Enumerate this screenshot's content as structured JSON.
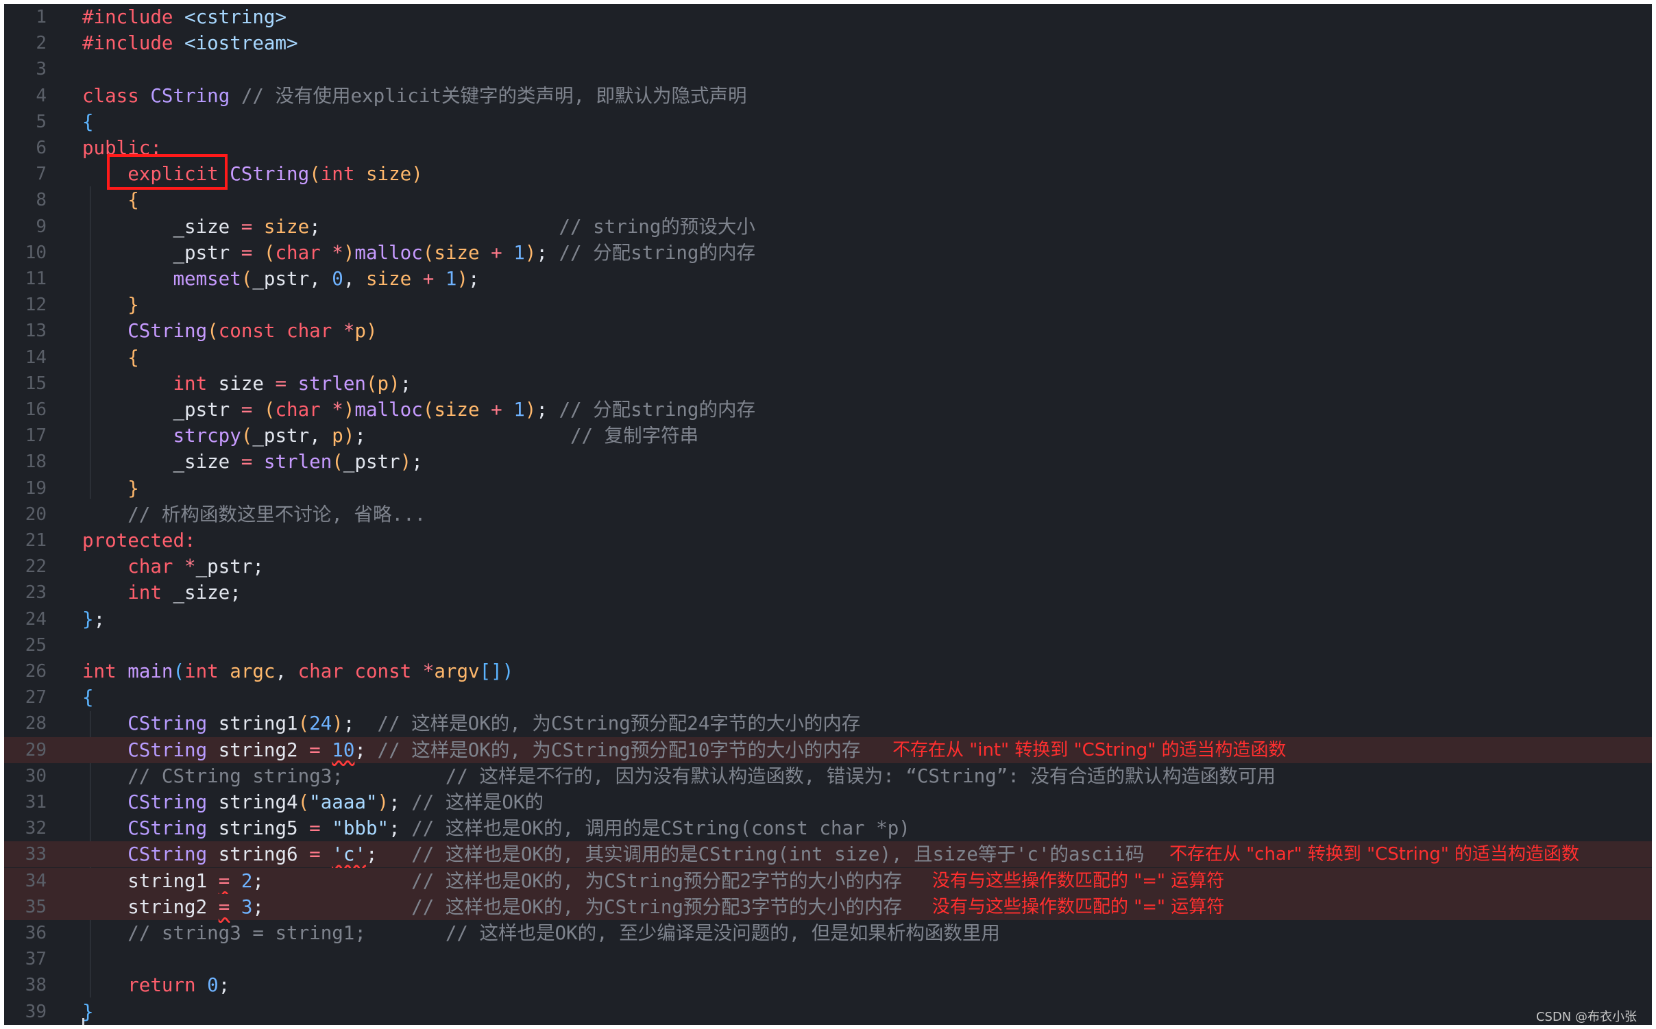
{
  "editor": {
    "lines": [
      {
        "n": "1",
        "tokens": [
          [
            "kw",
            "#include"
          ],
          [
            "txt",
            " "
          ],
          [
            "str",
            "<cstring>"
          ]
        ]
      },
      {
        "n": "2",
        "tokens": [
          [
            "kw",
            "#include"
          ],
          [
            "txt",
            " "
          ],
          [
            "str",
            "<iostream>"
          ]
        ]
      },
      {
        "n": "3",
        "tokens": []
      },
      {
        "n": "4",
        "tokens": [
          [
            "kw",
            "class"
          ],
          [
            "txt",
            " "
          ],
          [
            "cls",
            "CString"
          ],
          [
            "txt",
            " "
          ],
          [
            "cm",
            "// 没有使用explicit关键字的类声明, 即默认为隐式声明"
          ]
        ]
      },
      {
        "n": "5",
        "tokens": [
          [
            "b",
            "{"
          ]
        ]
      },
      {
        "n": "6",
        "tokens": [
          [
            "kw",
            "public:"
          ]
        ]
      },
      {
        "n": "7",
        "tokens": [
          [
            "txt",
            "    "
          ],
          [
            "kw",
            "explicit"
          ],
          [
            "txt",
            " "
          ],
          [
            "fn",
            "CString"
          ],
          [
            "pl",
            "("
          ],
          [
            "ty",
            "int"
          ],
          [
            "txt",
            " "
          ],
          [
            "p",
            "size"
          ],
          [
            "pl",
            ")"
          ]
        ]
      },
      {
        "n": "8",
        "tokens": [
          [
            "txt",
            "    "
          ],
          [
            "pl",
            "{"
          ]
        ]
      },
      {
        "n": "9",
        "tokens": [
          [
            "txt",
            "        _size "
          ],
          [
            "op",
            "="
          ],
          [
            "txt",
            " "
          ],
          [
            "p",
            "size"
          ],
          [
            "txt",
            ";                     "
          ],
          [
            "cm",
            "// string的预设大小"
          ]
        ]
      },
      {
        "n": "10",
        "tokens": [
          [
            "txt",
            "        _pstr "
          ],
          [
            "op",
            "="
          ],
          [
            "txt",
            " "
          ],
          [
            "pl",
            "("
          ],
          [
            "ty",
            "char"
          ],
          [
            "txt",
            " "
          ],
          [
            "op",
            "*"
          ],
          [
            "pl",
            ")"
          ],
          [
            "fn",
            "malloc"
          ],
          [
            "pl",
            "("
          ],
          [
            "p",
            "size"
          ],
          [
            "txt",
            " "
          ],
          [
            "op",
            "+"
          ],
          [
            "txt",
            " "
          ],
          [
            "num",
            "1"
          ],
          [
            "pl",
            ")"
          ],
          [
            "txt",
            "; "
          ],
          [
            "cm",
            "// 分配string的内存"
          ]
        ]
      },
      {
        "n": "11",
        "tokens": [
          [
            "txt",
            "        "
          ],
          [
            "fn",
            "memset"
          ],
          [
            "pl",
            "("
          ],
          [
            "txt",
            "_pstr, "
          ],
          [
            "num",
            "0"
          ],
          [
            "txt",
            ", "
          ],
          [
            "p",
            "size"
          ],
          [
            "txt",
            " "
          ],
          [
            "op",
            "+"
          ],
          [
            "txt",
            " "
          ],
          [
            "num",
            "1"
          ],
          [
            "pl",
            ")"
          ],
          [
            "txt",
            ";"
          ]
        ]
      },
      {
        "n": "12",
        "tokens": [
          [
            "txt",
            "    "
          ],
          [
            "pl",
            "}"
          ]
        ]
      },
      {
        "n": "13",
        "tokens": [
          [
            "txt",
            "    "
          ],
          [
            "fn",
            "CString"
          ],
          [
            "pl",
            "("
          ],
          [
            "ty",
            "const"
          ],
          [
            "txt",
            " "
          ],
          [
            "ty",
            "char"
          ],
          [
            "txt",
            " "
          ],
          [
            "op",
            "*"
          ],
          [
            "p",
            "p"
          ],
          [
            "pl",
            ")"
          ]
        ]
      },
      {
        "n": "14",
        "tokens": [
          [
            "txt",
            "    "
          ],
          [
            "pl",
            "{"
          ]
        ]
      },
      {
        "n": "15",
        "tokens": [
          [
            "txt",
            "        "
          ],
          [
            "ty",
            "int"
          ],
          [
            "txt",
            " size "
          ],
          [
            "op",
            "="
          ],
          [
            "txt",
            " "
          ],
          [
            "fn",
            "strlen"
          ],
          [
            "pl",
            "("
          ],
          [
            "p",
            "p"
          ],
          [
            "pl",
            ")"
          ],
          [
            "txt",
            ";"
          ]
        ]
      },
      {
        "n": "16",
        "tokens": [
          [
            "txt",
            "        _pstr "
          ],
          [
            "op",
            "="
          ],
          [
            "txt",
            " "
          ],
          [
            "pl",
            "("
          ],
          [
            "ty",
            "char"
          ],
          [
            "txt",
            " "
          ],
          [
            "op",
            "*"
          ],
          [
            "pl",
            ")"
          ],
          [
            "fn",
            "malloc"
          ],
          [
            "pl",
            "("
          ],
          [
            "p",
            "size"
          ],
          [
            "txt",
            " "
          ],
          [
            "op",
            "+"
          ],
          [
            "txt",
            " "
          ],
          [
            "num",
            "1"
          ],
          [
            "pl",
            ")"
          ],
          [
            "txt",
            "; "
          ],
          [
            "cm",
            "// 分配string的内存"
          ]
        ]
      },
      {
        "n": "17",
        "tokens": [
          [
            "txt",
            "        "
          ],
          [
            "fn",
            "strcpy"
          ],
          [
            "pl",
            "("
          ],
          [
            "txt",
            "_pstr, "
          ],
          [
            "p",
            "p"
          ],
          [
            "pl",
            ")"
          ],
          [
            "txt",
            ";                  "
          ],
          [
            "cm",
            "// 复制字符串"
          ]
        ]
      },
      {
        "n": "18",
        "tokens": [
          [
            "txt",
            "        _size "
          ],
          [
            "op",
            "="
          ],
          [
            "txt",
            " "
          ],
          [
            "fn",
            "strlen"
          ],
          [
            "pl",
            "("
          ],
          [
            "txt",
            "_pstr"
          ],
          [
            "pl",
            ")"
          ],
          [
            "txt",
            ";"
          ]
        ]
      },
      {
        "n": "19",
        "tokens": [
          [
            "txt",
            "    "
          ],
          [
            "pl",
            "}"
          ]
        ]
      },
      {
        "n": "20",
        "tokens": [
          [
            "txt",
            "    "
          ],
          [
            "cm",
            "// 析构函数这里不讨论, 省略..."
          ]
        ]
      },
      {
        "n": "21",
        "tokens": [
          [
            "kw",
            "protected:"
          ]
        ]
      },
      {
        "n": "22",
        "tokens": [
          [
            "txt",
            "    "
          ],
          [
            "ty",
            "char"
          ],
          [
            "txt",
            " "
          ],
          [
            "op",
            "*"
          ],
          [
            "txt",
            "_pstr;"
          ]
        ]
      },
      {
        "n": "23",
        "tokens": [
          [
            "txt",
            "    "
          ],
          [
            "ty",
            "int"
          ],
          [
            "txt",
            " _size;"
          ]
        ]
      },
      {
        "n": "24",
        "tokens": [
          [
            "b",
            "}"
          ],
          [
            "txt",
            ";"
          ]
        ]
      },
      {
        "n": "25",
        "tokens": []
      },
      {
        "n": "26",
        "tokens": [
          [
            "ty",
            "int"
          ],
          [
            "txt",
            " "
          ],
          [
            "fn",
            "main"
          ],
          [
            "b",
            "("
          ],
          [
            "ty",
            "int"
          ],
          [
            "txt",
            " "
          ],
          [
            "p",
            "argc"
          ],
          [
            "txt",
            ", "
          ],
          [
            "ty",
            "char"
          ],
          [
            "txt",
            " "
          ],
          [
            "ty",
            "const"
          ],
          [
            "txt",
            " "
          ],
          [
            "op",
            "*"
          ],
          [
            "p",
            "argv"
          ],
          [
            "b",
            "[]"
          ],
          [
            "b",
            ")"
          ]
        ]
      },
      {
        "n": "27",
        "tokens": [
          [
            "b",
            "{"
          ]
        ]
      },
      {
        "n": "28",
        "tokens": [
          [
            "txt",
            "    "
          ],
          [
            "cls",
            "CString"
          ],
          [
            "txt",
            " string1"
          ],
          [
            "pl",
            "("
          ],
          [
            "num",
            "24"
          ],
          [
            "pl",
            ")"
          ],
          [
            "txt",
            ";  "
          ],
          [
            "cm",
            "// 这样是OK的, 为CString预分配24字节的大小的内存"
          ]
        ]
      },
      {
        "n": "29",
        "err": true,
        "tokens": [
          [
            "txt",
            "    "
          ],
          [
            "cls",
            "CString"
          ],
          [
            "txt",
            " string2 "
          ],
          [
            "op",
            "="
          ],
          [
            "txt",
            " "
          ],
          [
            "numsq",
            "10"
          ],
          [
            "txt",
            "; "
          ],
          [
            "cm",
            "// 这样是OK的, 为CString预分配10字节的大小的内存"
          ]
        ],
        "msg": "不存在从 \"int\" 转换到 \"CString\" 的适当构造函数",
        "msgLeft": 1296
      },
      {
        "n": "30",
        "tokens": [
          [
            "txt",
            "    "
          ],
          [
            "cm",
            "// CString string3;         // 这样是不行的, 因为没有默认构造函数, 错误为: “CString”: 没有合适的默认构造函数可用"
          ]
        ]
      },
      {
        "n": "31",
        "tokens": [
          [
            "txt",
            "    "
          ],
          [
            "cls",
            "CString"
          ],
          [
            "txt",
            " string4"
          ],
          [
            "pl",
            "("
          ],
          [
            "str",
            "\"aaaa\""
          ],
          [
            "pl",
            ")"
          ],
          [
            "txt",
            "; "
          ],
          [
            "cm",
            "// 这样是OK的"
          ]
        ]
      },
      {
        "n": "32",
        "tokens": [
          [
            "txt",
            "    "
          ],
          [
            "cls",
            "CString"
          ],
          [
            "txt",
            " string5 "
          ],
          [
            "op",
            "="
          ],
          [
            "txt",
            " "
          ],
          [
            "str",
            "\"bbb\""
          ],
          [
            "txt",
            "; "
          ],
          [
            "cm",
            "// 这样也是OK的, 调用的是CString(const char *p)"
          ]
        ]
      },
      {
        "n": "33",
        "err": true,
        "tokens": [
          [
            "txt",
            "    "
          ],
          [
            "cls",
            "CString"
          ],
          [
            "txt",
            " string6 "
          ],
          [
            "op",
            "="
          ],
          [
            "txt",
            " "
          ],
          [
            "strsq",
            "'c'"
          ],
          [
            "txt",
            ";   "
          ],
          [
            "cm",
            "// 这样也是OK的, 其实调用的是CString(int size), 且size等于'c'的ascii码"
          ]
        ],
        "msg": "不存在从 \"char\" 转换到 \"CString\" 的适当构造函数",
        "msgLeft": 1700
      },
      {
        "n": "34",
        "err": true,
        "tokens": [
          [
            "txt",
            "    string1 "
          ],
          [
            "opsq",
            "="
          ],
          [
            "txt",
            " "
          ],
          [
            "num",
            "2"
          ],
          [
            "txt",
            ";             "
          ],
          [
            "cm",
            "// 这样也是OK的, 为CString预分配2字节的大小的内存"
          ]
        ],
        "msg": "没有与这些操作数匹配的 \"=\" 运算符",
        "msgLeft": 1354
      },
      {
        "n": "35",
        "err": true,
        "tokens": [
          [
            "txt",
            "    string2 "
          ],
          [
            "opsq",
            "="
          ],
          [
            "txt",
            " "
          ],
          [
            "num",
            "3"
          ],
          [
            "txt",
            ";             "
          ],
          [
            "cm",
            "// 这样也是OK的, 为CString预分配3字节的大小的内存"
          ]
        ],
        "msg": "没有与这些操作数匹配的 \"=\" 运算符",
        "msgLeft": 1354
      },
      {
        "n": "36",
        "tokens": [
          [
            "txt",
            "    "
          ],
          [
            "cm",
            "// string3 = string1;       // 这样也是OK的, 至少编译是没问题的, 但是如果析构函数里用"
          ]
        ]
      },
      {
        "n": "37",
        "tokens": []
      },
      {
        "n": "38",
        "tokens": [
          [
            "txt",
            "    "
          ],
          [
            "kw",
            "return"
          ],
          [
            "txt",
            " "
          ],
          [
            "num",
            "0"
          ],
          [
            "txt",
            ";"
          ]
        ]
      },
      {
        "n": "39",
        "tokens": [
          [
            "b",
            "}"
          ]
        ]
      }
    ]
  },
  "watermark": "CSDN @布衣小张"
}
